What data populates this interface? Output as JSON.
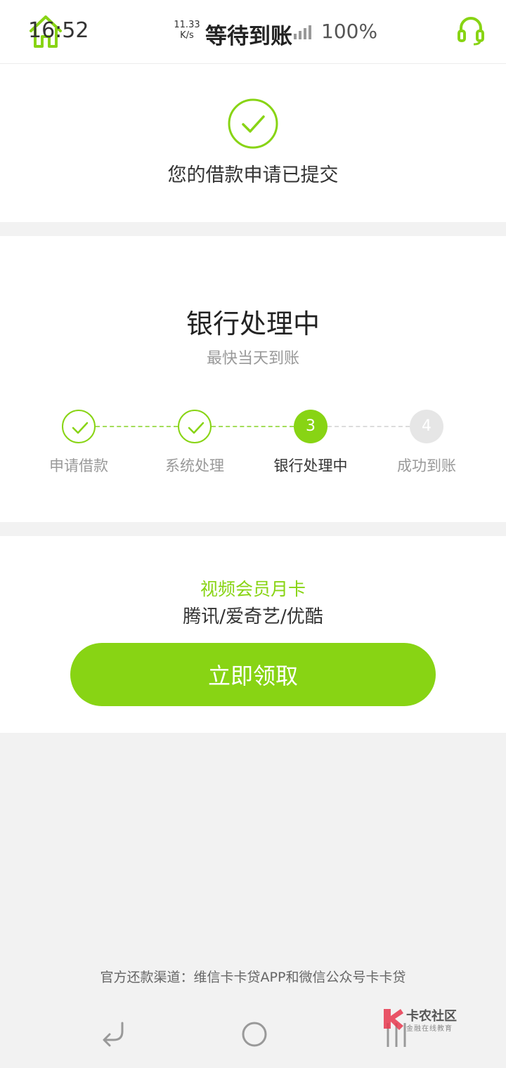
{
  "status_bar": {
    "time": "16:52",
    "net_speed_value": "11.33",
    "net_speed_unit": "K/s",
    "battery": "100%"
  },
  "header": {
    "title": "等待到账"
  },
  "submit": {
    "message": "您的借款申请已提交"
  },
  "progress": {
    "title": "银行处理中",
    "subtitle": "最快当天到账",
    "steps": [
      {
        "label": "申请借款",
        "state": "done"
      },
      {
        "label": "系统处理",
        "state": "done"
      },
      {
        "label": "银行处理中",
        "state": "current",
        "number": "3"
      },
      {
        "label": "成功到账",
        "state": "pending",
        "number": "4"
      }
    ]
  },
  "promo": {
    "title": "视频会员月卡",
    "description": "腾讯/爱奇艺/优酷",
    "button_label": "立即领取"
  },
  "footer": {
    "note": "官方还款渠道：维信卡卡贷APP和微信公众号卡卡贷"
  },
  "watermark": {
    "title": "卡农社区",
    "subtitle": "金融在线教育"
  },
  "colors": {
    "accent": "#88d414",
    "background": "#f2f2f2",
    "pending": "#e6e6e6"
  }
}
